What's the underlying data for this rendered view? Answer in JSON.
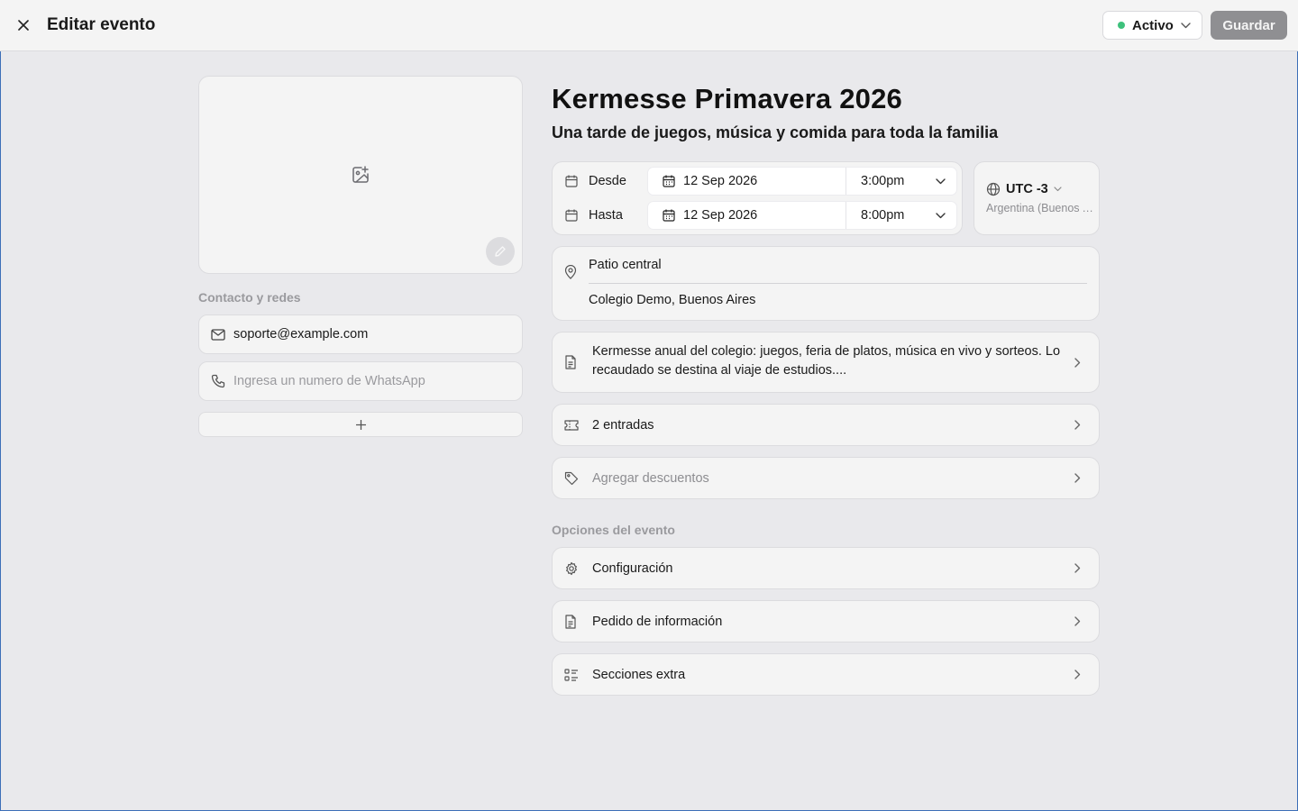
{
  "header": {
    "title": "Editar evento",
    "status_label": "Activo",
    "status_color": "#3ec17c",
    "save_label": "Guardar"
  },
  "contact": {
    "section_label": "Contacto y redes",
    "email": "soporte@example.com",
    "whatsapp_placeholder": "Ingresa un numero de WhatsApp"
  },
  "event": {
    "title": "Kermesse Primavera 2026",
    "subtitle": "Una tarde de juegos, música y comida para toda la familia",
    "from_label": "Desde",
    "from_date": "12 Sep 2026",
    "from_time": "3:00pm",
    "to_label": "Hasta",
    "to_date": "12 Sep 2026",
    "to_time": "8:00pm",
    "timezone": "UTC -3",
    "timezone_region": "Argentina (Buenos Aires)",
    "location_name": "Patio central",
    "location_address": "Colegio Demo, Buenos Aires",
    "description": "Kermesse anual del colegio: juegos, feria de platos, música en vivo y sorteos. Lo recaudado se destina al viaje de estudios....",
    "tickets": "2 entradas",
    "discounts_placeholder": "Agregar descuentos"
  },
  "options": {
    "section_label": "Opciones del evento",
    "items": [
      {
        "label": "Configuración",
        "icon": "gear-icon"
      },
      {
        "label": "Pedido de información",
        "icon": "document-icon"
      },
      {
        "label": "Secciones extra",
        "icon": "list-icon"
      }
    ]
  }
}
